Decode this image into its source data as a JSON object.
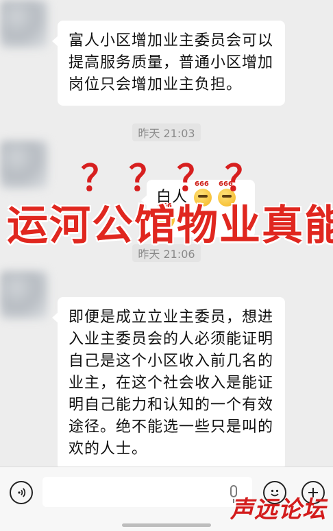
{
  "chat": {
    "messages": [
      {
        "type": "text",
        "text": "富人小区增加业主委员会可以提高服务质量，普通小区增加岗位只会增加业主负担。"
      },
      {
        "type": "time",
        "text": "昨天 21:03"
      },
      {
        "type": "text",
        "text": "白人"
      },
      {
        "type": "time",
        "text": "昨天 21:06"
      },
      {
        "type": "text",
        "text": "即便是成立立业主委员，想进入业主委员会的人必须能证明自己是这个小区收入前几名的业主，在这个社会收入是能证明自己能力和认知的一个有效途径。绝不能选一些只是叫的欢的人士。"
      }
    ],
    "emoji_label": "666"
  },
  "overlay": {
    "marks": "？？？？",
    "title": "运河公馆物业真能"
  },
  "input": {
    "voice_icon": "voice-icon",
    "emoji_icon": "emoji-icon",
    "plus_icon": "plus-icon"
  },
  "watermark": "声远论坛",
  "colors": {
    "background": "#ededed",
    "bubble": "#ffffff",
    "overlay_red": "#e0271f"
  }
}
